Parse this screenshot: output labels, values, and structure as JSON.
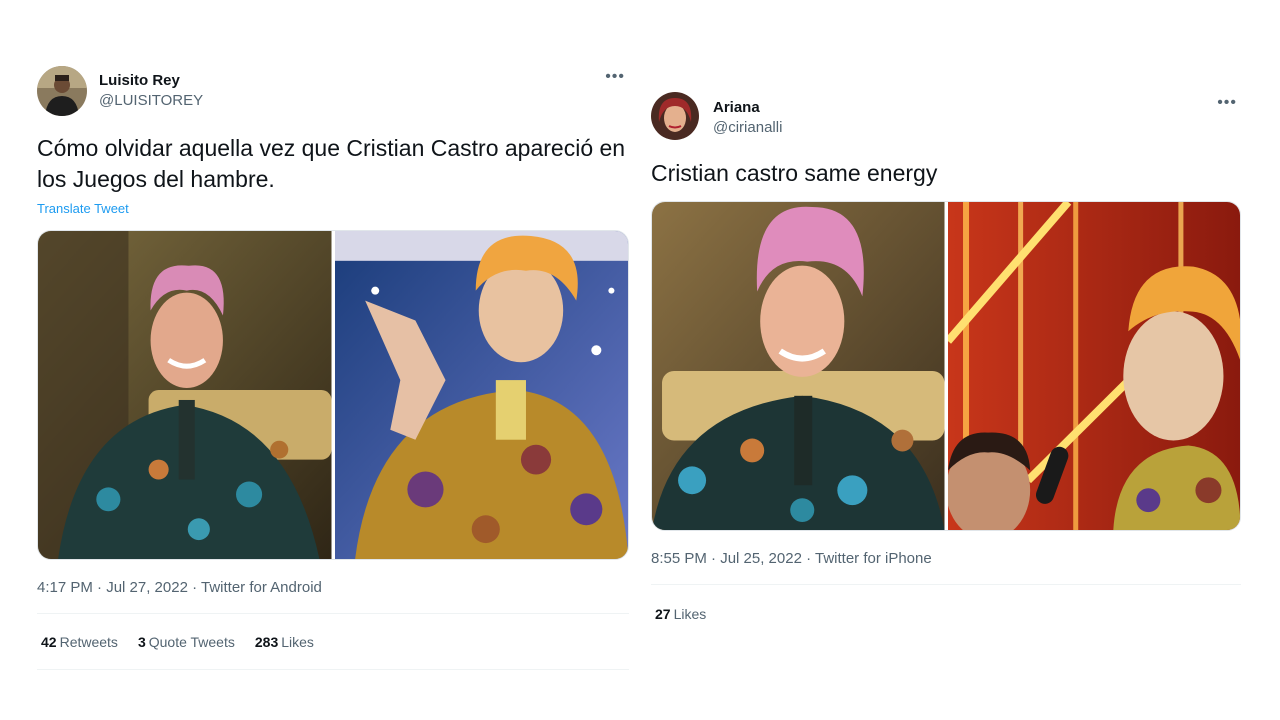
{
  "tweets": [
    {
      "display_name": "Luisito Rey",
      "handle": "@LUISITOREY",
      "more_icon": "more-horizontal-icon",
      "text": "Cómo olvidar aquella vez que Cristian Castro apareció en los Juegos del hambre.",
      "translate_label": "Translate Tweet",
      "meta": "4:17 PM · Jul 27, 2022 · Twitter for Android",
      "stats": [
        {
          "count": "42",
          "label": "Retweets"
        },
        {
          "count": "3",
          "label": "Quote Tweets"
        },
        {
          "count": "283",
          "label": "Likes"
        }
      ],
      "colors": {
        "link": "#1d9bf0",
        "secondary_text": "#536471"
      }
    },
    {
      "display_name": "Ariana",
      "handle": "@cirianalli",
      "more_icon": "more-horizontal-icon",
      "text": "Cristian castro same energy",
      "meta": "8:55 PM · Jul 25, 2022 · Twitter for iPhone",
      "stats": [
        {
          "count": "27",
          "label": "Likes"
        }
      ]
    }
  ]
}
